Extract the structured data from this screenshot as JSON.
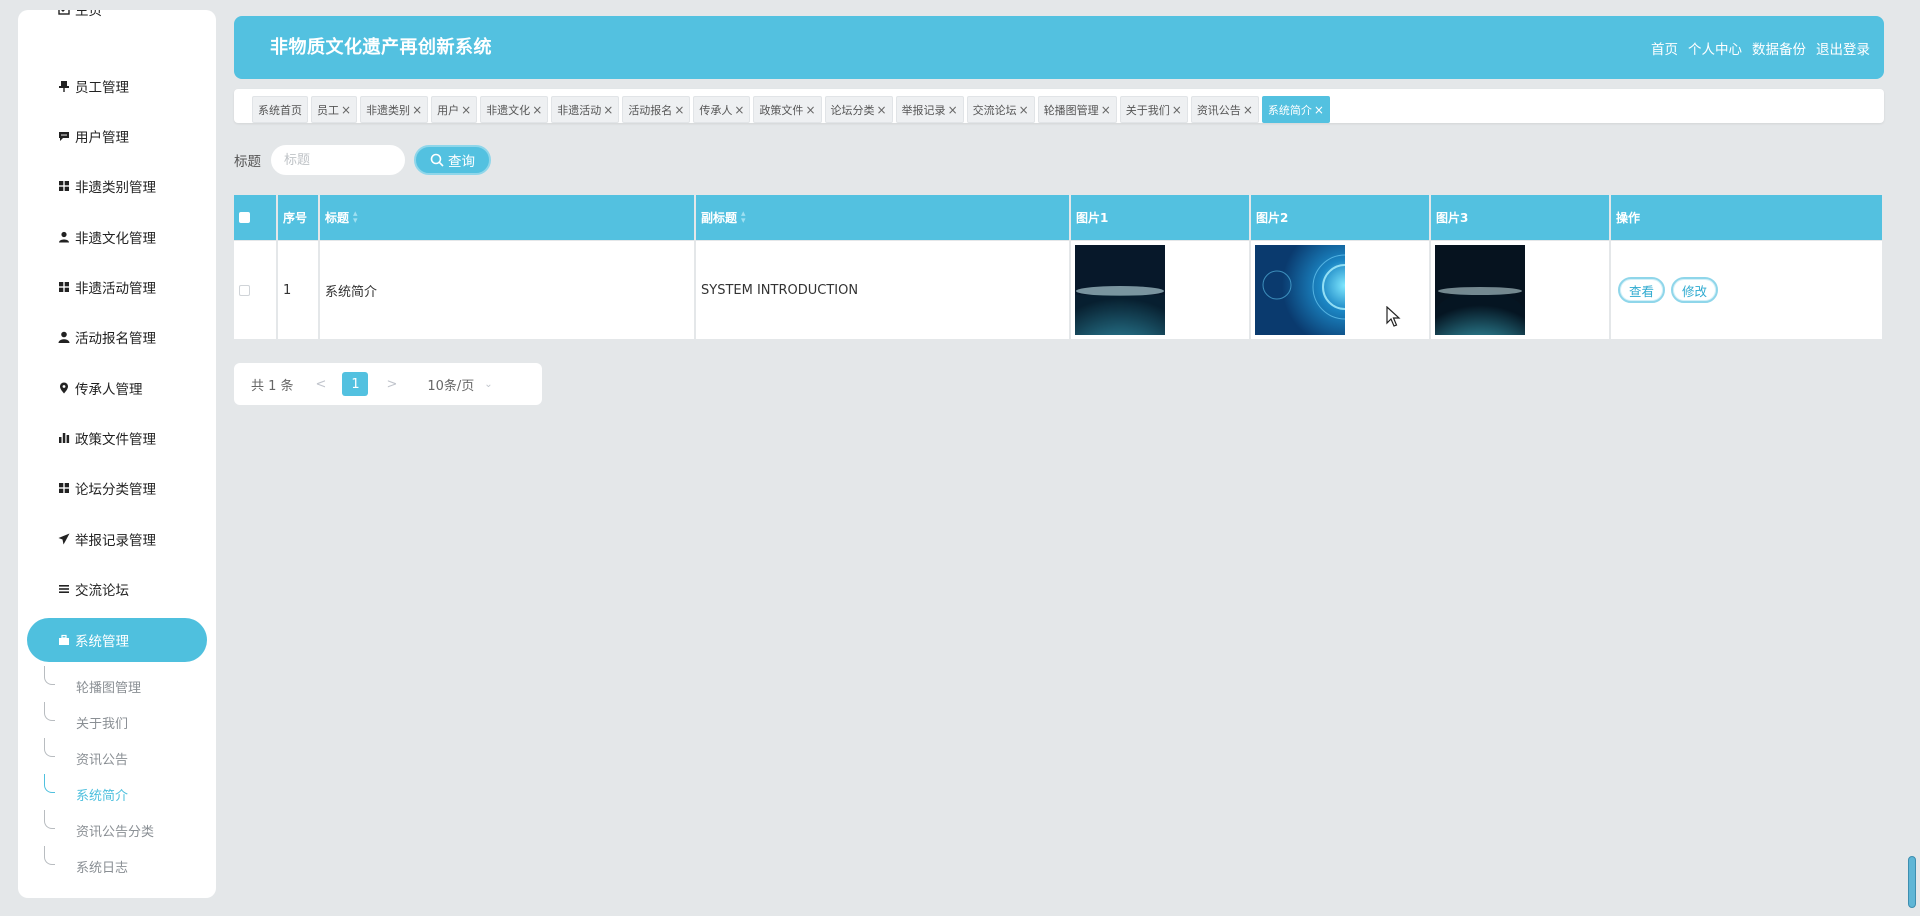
{
  "app": {
    "title": "非物质文化遗产再创新系统"
  },
  "header_nav": [
    "首页",
    "个人中心",
    "数据备份",
    "退出登录"
  ],
  "sidebar": {
    "items": [
      {
        "label": "主页",
        "icon": "home-icon"
      },
      {
        "label": "员工管理",
        "icon": "pin-icon"
      },
      {
        "label": "用户管理",
        "icon": "chat-icon"
      },
      {
        "label": "非遗类别管理",
        "icon": "grid-icon"
      },
      {
        "label": "非遗文化管理",
        "icon": "person-icon"
      },
      {
        "label": "非遗活动管理",
        "icon": "grid-icon"
      },
      {
        "label": "活动报名管理",
        "icon": "user-icon"
      },
      {
        "label": "传承人管理",
        "icon": "location-icon"
      },
      {
        "label": "政策文件管理",
        "icon": "bar-chart-icon"
      },
      {
        "label": "论坛分类管理",
        "icon": "grid-icon"
      },
      {
        "label": "举报记录管理",
        "icon": "send-icon"
      },
      {
        "label": "交流论坛",
        "icon": "list-icon"
      }
    ],
    "active": {
      "label": "系统管理",
      "icon": "briefcase-icon"
    },
    "subitems": [
      "轮播图管理",
      "关于我们",
      "资讯公告",
      "系统简介",
      "资讯公告分类",
      "系统日志"
    ],
    "active_subitem": "系统简介"
  },
  "tabs": [
    {
      "label": "系统首页",
      "closable": false
    },
    {
      "label": "员工",
      "closable": true
    },
    {
      "label": "非遗类别",
      "closable": true
    },
    {
      "label": "用户",
      "closable": true
    },
    {
      "label": "非遗文化",
      "closable": true
    },
    {
      "label": "非遗活动",
      "closable": true
    },
    {
      "label": "活动报名",
      "closable": true
    },
    {
      "label": "传承人",
      "closable": true
    },
    {
      "label": "政策文件",
      "closable": true
    },
    {
      "label": "论坛分类",
      "closable": true
    },
    {
      "label": "举报记录",
      "closable": true
    },
    {
      "label": "交流论坛",
      "closable": true
    },
    {
      "label": "轮播图管理",
      "closable": true
    },
    {
      "label": "关于我们",
      "closable": true
    },
    {
      "label": "资讯公告",
      "closable": true
    },
    {
      "label": "系统简介",
      "closable": true,
      "active": true
    }
  ],
  "tab_close_glyph": "×",
  "search": {
    "label": "标题",
    "placeholder": "标题",
    "button": "查询"
  },
  "table": {
    "columns": [
      "序号",
      "标题",
      "副标题",
      "图片1",
      "图片2",
      "图片3",
      "操作"
    ],
    "rows": [
      {
        "index": "1",
        "title": "系统简介",
        "subtitle": "SYSTEM INTRODUCTION",
        "actions": [
          "查看",
          "修改"
        ]
      }
    ]
  },
  "pagination": {
    "total": "共 1 条",
    "prev": "<",
    "current": "1",
    "next": ">",
    "page_size": "10条/页"
  },
  "colors": {
    "accent": "#53c1e0",
    "background": "#e4e7e9",
    "white": "#ffffff"
  }
}
